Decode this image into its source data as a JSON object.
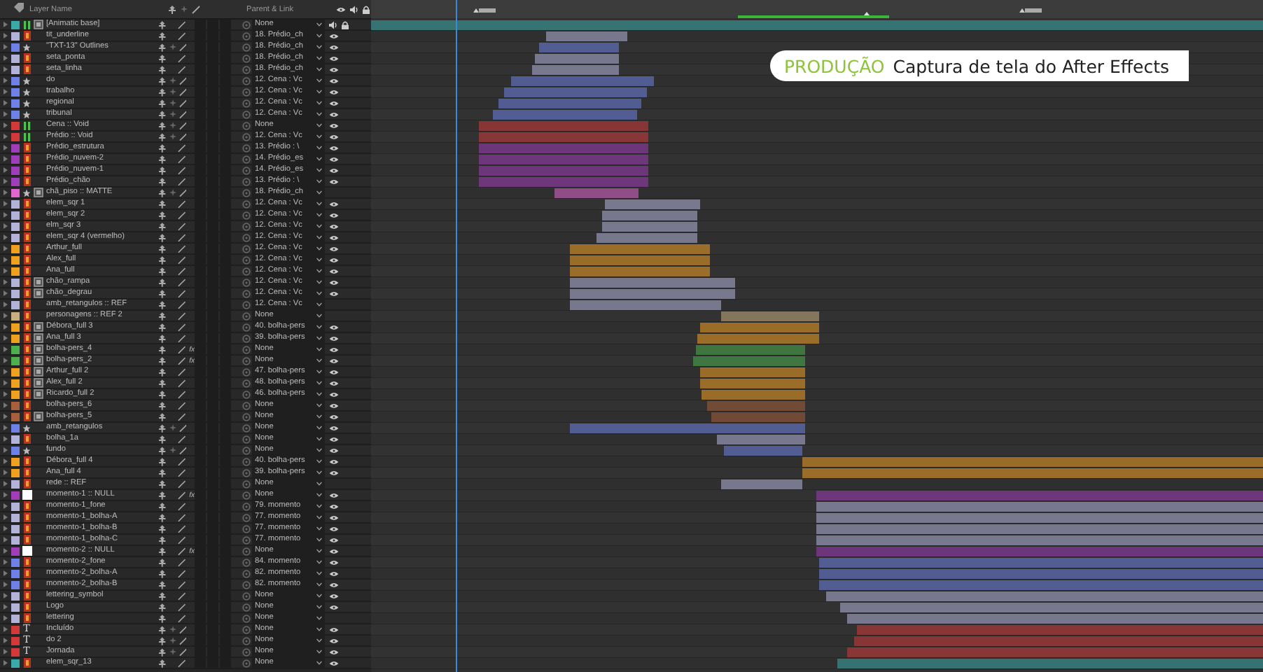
{
  "header": {
    "layer_name": "Layer Name",
    "parent_link": "Parent & Link"
  },
  "layers": [
    {
      "name": "[Animatic base]",
      "color": "#3aaaa8",
      "kind": "comp",
      "boxed": true,
      "effects": false,
      "parent": "None",
      "visible": false,
      "audio": true,
      "locked": true
    },
    {
      "name": "tit_underline",
      "color": "#b3b3da",
      "kind": "file",
      "boxed": false,
      "effects": false,
      "parent": "18. Prédio_ch",
      "visible": true,
      "audio": false,
      "locked": false
    },
    {
      "name": "\"TXT-13\" Outlines",
      "color": "#6d81e6",
      "kind": "shape",
      "boxed": false,
      "effects": false,
      "parent": "18. Prédio_ch",
      "visible": true,
      "audio": false,
      "locked": false
    },
    {
      "name": "seta_ponta",
      "color": "#b3b3da",
      "kind": "file",
      "boxed": false,
      "effects": false,
      "parent": "18. Prédio_ch",
      "visible": true,
      "audio": false,
      "locked": false
    },
    {
      "name": "seta_linha",
      "color": "#b3b3da",
      "kind": "file",
      "boxed": false,
      "effects": false,
      "parent": "18. Prédio_ch",
      "visible": true,
      "audio": false,
      "locked": false
    },
    {
      "name": "do",
      "color": "#6d81e6",
      "kind": "shape",
      "boxed": false,
      "effects": false,
      "parent": "12. Cena : Vc",
      "visible": true,
      "audio": false,
      "locked": false
    },
    {
      "name": "trabalho",
      "color": "#6d81e6",
      "kind": "shape",
      "boxed": false,
      "effects": false,
      "parent": "12. Cena : Vc",
      "visible": true,
      "audio": false,
      "locked": false
    },
    {
      "name": "regional",
      "color": "#6d81e6",
      "kind": "shape",
      "boxed": false,
      "effects": false,
      "parent": "12. Cena : Vc",
      "visible": true,
      "audio": false,
      "locked": false
    },
    {
      "name": "tribunal",
      "color": "#6d81e6",
      "kind": "shape",
      "boxed": false,
      "effects": false,
      "parent": "12. Cena : Vc",
      "visible": true,
      "audio": false,
      "locked": false
    },
    {
      "name": "Cena :: Void",
      "color": "#d23a3a",
      "kind": "comp",
      "boxed": false,
      "effects": false,
      "parent": "None",
      "visible": true,
      "audio": false,
      "locked": false
    },
    {
      "name": "Prédio :: Void",
      "color": "#d23a3a",
      "kind": "comp",
      "boxed": false,
      "effects": false,
      "parent": "12. Cena : Vc",
      "visible": true,
      "audio": false,
      "locked": false
    },
    {
      "name": "Prédio_estrutura",
      "color": "#a03db8",
      "kind": "file",
      "boxed": false,
      "effects": false,
      "parent": "13. Prédio : \\",
      "visible": true,
      "audio": false,
      "locked": false
    },
    {
      "name": "Prédio_nuvem-2",
      "color": "#a03db8",
      "kind": "file",
      "boxed": false,
      "effects": false,
      "parent": "14. Prédio_es",
      "visible": true,
      "audio": false,
      "locked": false
    },
    {
      "name": "Prédio_nuvem-1",
      "color": "#a03db8",
      "kind": "file",
      "boxed": false,
      "effects": false,
      "parent": "14. Prédio_es",
      "visible": true,
      "audio": false,
      "locked": false
    },
    {
      "name": "Prédio_chão",
      "color": "#a03db8",
      "kind": "file",
      "boxed": false,
      "effects": false,
      "parent": "13. Prédio : \\",
      "visible": true,
      "audio": false,
      "locked": false
    },
    {
      "name": "chã_piso :: MATTE",
      "color": "#e067d0",
      "kind": "shape",
      "boxed": true,
      "effects": false,
      "parent": "18. Prédio_ch",
      "visible": false,
      "audio": false,
      "locked": false
    },
    {
      "name": "elem_sqr 1",
      "color": "#b3b3da",
      "kind": "file",
      "boxed": false,
      "effects": false,
      "parent": "12. Cena : Vc",
      "visible": true,
      "audio": false,
      "locked": false
    },
    {
      "name": "elem_sqr 2",
      "color": "#b3b3da",
      "kind": "file",
      "boxed": false,
      "effects": false,
      "parent": "12. Cena : Vc",
      "visible": true,
      "audio": false,
      "locked": false
    },
    {
      "name": "elm_sqr 3",
      "color": "#b3b3da",
      "kind": "file",
      "boxed": false,
      "effects": false,
      "parent": "12. Cena : Vc",
      "visible": true,
      "audio": false,
      "locked": false
    },
    {
      "name": "elem_sqr 4 (vermelho)",
      "color": "#b3b3da",
      "kind": "file",
      "boxed": false,
      "effects": false,
      "parent": "12. Cena : Vc",
      "visible": true,
      "audio": false,
      "locked": false
    },
    {
      "name": "Arthur_full",
      "color": "#f0a020",
      "kind": "file",
      "boxed": false,
      "effects": false,
      "parent": "12. Cena : Vc",
      "visible": true,
      "audio": false,
      "locked": false
    },
    {
      "name": "Alex_full",
      "color": "#f0a020",
      "kind": "file",
      "boxed": false,
      "effects": false,
      "parent": "12. Cena : Vc",
      "visible": true,
      "audio": false,
      "locked": false
    },
    {
      "name": "Ana_full",
      "color": "#f0a020",
      "kind": "file",
      "boxed": false,
      "effects": false,
      "parent": "12. Cena : Vc",
      "visible": true,
      "audio": false,
      "locked": false
    },
    {
      "name": "chão_rampa",
      "color": "#b3b3da",
      "kind": "file",
      "boxed": true,
      "effects": false,
      "parent": "12. Cena : Vc",
      "visible": true,
      "audio": false,
      "locked": false
    },
    {
      "name": "chão_degrau",
      "color": "#b3b3da",
      "kind": "file",
      "boxed": true,
      "effects": false,
      "parent": "12. Cena : Vc",
      "visible": true,
      "audio": false,
      "locked": false
    },
    {
      "name": "amb_retangulos :: REF",
      "color": "#b3b3da",
      "kind": "file",
      "boxed": false,
      "effects": false,
      "parent": "12. Cena : Vc",
      "visible": false,
      "audio": false,
      "locked": false
    },
    {
      "name": "personagens :: REF 2",
      "color": "#c9ae82",
      "kind": "file",
      "boxed": false,
      "effects": false,
      "parent": "None",
      "visible": false,
      "audio": false,
      "locked": false
    },
    {
      "name": "Débora_full 3",
      "color": "#f0a020",
      "kind": "file",
      "boxed": true,
      "effects": false,
      "parent": "40. bolha-pers",
      "visible": true,
      "audio": false,
      "locked": false
    },
    {
      "name": "Ana_full 3",
      "color": "#f0a020",
      "kind": "file",
      "boxed": true,
      "effects": false,
      "parent": "39. bolha-pers",
      "visible": true,
      "audio": false,
      "locked": false
    },
    {
      "name": "bolha-pers_4",
      "color": "#4cb04c",
      "kind": "file",
      "boxed": true,
      "effects": true,
      "fx": "fx",
      "parent": "None",
      "visible": true,
      "audio": false,
      "locked": false
    },
    {
      "name": "bolha-pers_2",
      "color": "#4cb04c",
      "kind": "file",
      "boxed": true,
      "effects": true,
      "fx": "fx",
      "parent": "None",
      "visible": true,
      "audio": false,
      "locked": false
    },
    {
      "name": "Arthur_full 2",
      "color": "#f0a020",
      "kind": "file",
      "boxed": true,
      "effects": false,
      "parent": "47. bolha-pers",
      "visible": true,
      "audio": false,
      "locked": false
    },
    {
      "name": "Alex_full 2",
      "color": "#f0a020",
      "kind": "file",
      "boxed": true,
      "effects": false,
      "parent": "48. bolha-pers",
      "visible": true,
      "audio": false,
      "locked": false
    },
    {
      "name": "Ricardo_full 2",
      "color": "#f0a020",
      "kind": "file",
      "boxed": true,
      "effects": false,
      "parent": "46. bolha-pers",
      "visible": true,
      "audio": false,
      "locked": false
    },
    {
      "name": "bolha-pers_6",
      "color": "#a8603c",
      "kind": "file",
      "boxed": false,
      "effects": false,
      "parent": "None",
      "visible": true,
      "audio": false,
      "locked": false
    },
    {
      "name": "bolha-pers_5",
      "color": "#a8603c",
      "kind": "file",
      "boxed": true,
      "effects": false,
      "parent": "None",
      "visible": true,
      "audio": false,
      "locked": false
    },
    {
      "name": "amb_retangulos",
      "color": "#6d81e6",
      "kind": "shape",
      "boxed": false,
      "effects": false,
      "parent": "None",
      "visible": true,
      "audio": false,
      "locked": false
    },
    {
      "name": "bolha_1a",
      "color": "#b3b3da",
      "kind": "file",
      "boxed": false,
      "effects": false,
      "parent": "None",
      "visible": true,
      "audio": false,
      "locked": false
    },
    {
      "name": "fundo",
      "color": "#6d81e6",
      "kind": "shape",
      "boxed": false,
      "effects": false,
      "parent": "None",
      "visible": true,
      "audio": false,
      "locked": false
    },
    {
      "name": "Débora_full 4",
      "color": "#f0a020",
      "kind": "file",
      "boxed": false,
      "effects": false,
      "parent": "40. bolha-pers",
      "visible": true,
      "audio": false,
      "locked": false
    },
    {
      "name": "Ana_full 4",
      "color": "#f0a020",
      "kind": "file",
      "boxed": false,
      "effects": false,
      "parent": "39. bolha-pers",
      "visible": true,
      "audio": false,
      "locked": false
    },
    {
      "name": "rede :: REF",
      "color": "#b3b3da",
      "kind": "file",
      "boxed": false,
      "effects": false,
      "parent": "None",
      "visible": false,
      "audio": false,
      "locked": false
    },
    {
      "name": "momento-1 :: NULL",
      "color": "#a03db8",
      "kind": "null",
      "boxed": false,
      "effects": true,
      "fx": "fx",
      "parent": "None",
      "visible": true,
      "audio": false,
      "locked": false
    },
    {
      "name": "momento-1_fone",
      "color": "#b3b3da",
      "kind": "file",
      "boxed": false,
      "effects": false,
      "parent": "79. momento",
      "visible": true,
      "audio": false,
      "locked": false
    },
    {
      "name": "momento-1_bolha-A",
      "color": "#b3b3da",
      "kind": "file",
      "boxed": false,
      "effects": false,
      "parent": "77. momento",
      "visible": true,
      "audio": false,
      "locked": false
    },
    {
      "name": "momento-1_bolha-B",
      "color": "#b3b3da",
      "kind": "file",
      "boxed": false,
      "effects": false,
      "parent": "77. momento",
      "visible": true,
      "audio": false,
      "locked": false
    },
    {
      "name": "momento-1_bolha-C",
      "color": "#b3b3da",
      "kind": "file",
      "boxed": false,
      "effects": false,
      "parent": "77. momento",
      "visible": true,
      "audio": false,
      "locked": false
    },
    {
      "name": "momento-2 :: NULL",
      "color": "#a03db8",
      "kind": "null",
      "boxed": false,
      "effects": true,
      "fx": "fx",
      "parent": "None",
      "visible": true,
      "audio": false,
      "locked": false
    },
    {
      "name": "momento-2_fone",
      "color": "#6d81e6",
      "kind": "file",
      "boxed": false,
      "effects": false,
      "parent": "84. momento",
      "visible": true,
      "audio": false,
      "locked": false
    },
    {
      "name": "momento-2_bolha-A",
      "color": "#6d81e6",
      "kind": "file",
      "boxed": false,
      "effects": false,
      "parent": "82. momento",
      "visible": true,
      "audio": false,
      "locked": false
    },
    {
      "name": "momento-2_bolha-B",
      "color": "#6d81e6",
      "kind": "file",
      "boxed": false,
      "effects": false,
      "parent": "82. momento",
      "visible": true,
      "audio": false,
      "locked": false
    },
    {
      "name": "lettering_symbol",
      "color": "#b3b3da",
      "kind": "file",
      "boxed": false,
      "effects": false,
      "parent": "None",
      "visible": true,
      "audio": false,
      "locked": false
    },
    {
      "name": "Logo",
      "color": "#b3b3da",
      "kind": "file",
      "boxed": false,
      "effects": false,
      "parent": "None",
      "visible": true,
      "audio": false,
      "locked": false
    },
    {
      "name": "lettering",
      "color": "#b3b3da",
      "kind": "file",
      "boxed": false,
      "effects": false,
      "parent": "None",
      "visible": false,
      "audio": false,
      "locked": false
    },
    {
      "name": "Incluído",
      "color": "#d23a3a",
      "kind": "text",
      "glyph": "T",
      "boxed": false,
      "effects": false,
      "parent": "None",
      "visible": true,
      "audio": false,
      "locked": false
    },
    {
      "name": "do 2",
      "color": "#d23a3a",
      "kind": "text",
      "glyph": "T",
      "boxed": false,
      "effects": false,
      "parent": "None",
      "visible": true,
      "audio": false,
      "locked": false
    },
    {
      "name": "Jornada",
      "color": "#d23a3a",
      "kind": "text",
      "glyph": "T",
      "boxed": false,
      "effects": false,
      "parent": "None",
      "visible": true,
      "audio": false,
      "locked": false
    },
    {
      "name": "elem_sqr_13",
      "color": "#3aaaa8",
      "kind": "file",
      "boxed": false,
      "effects": false,
      "parent": "None",
      "visible": true,
      "audio": false,
      "locked": false
    }
  ],
  "caption": {
    "tag": "PRODUÇÃO",
    "text": "Captura de tela do After Effects"
  }
}
